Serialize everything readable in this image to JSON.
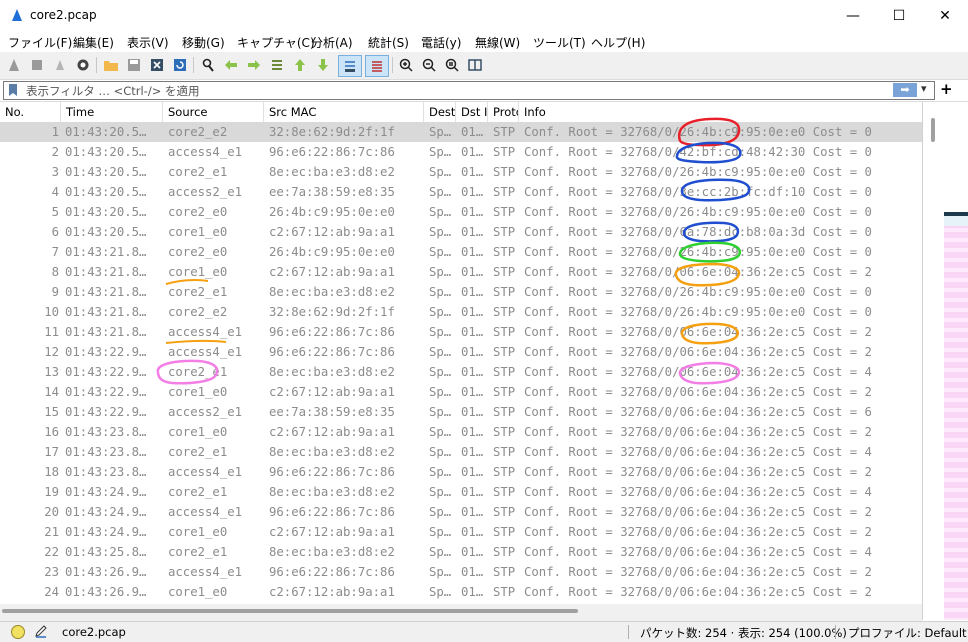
{
  "window": {
    "title": "core2.pcap",
    "min": "—",
    "max": "☐",
    "close": "✕"
  },
  "menu": [
    "ファイル(F)",
    "編集(E)",
    "表示(V)",
    "移動(G)",
    "キャプチャ(C)",
    "分析(A)",
    "統計(S)",
    "電話(y)",
    "無線(W)",
    "ツール(T)",
    "ヘルプ(H)"
  ],
  "toolbar_icons": [
    "shark-fin-start-icon",
    "stop-icon",
    "restart-icon",
    "options-gear-icon",
    "open-folder-icon",
    "save-icon",
    "close-file-icon",
    "reload-icon",
    "find-icon",
    "back-arrow-icon",
    "forward-arrow-icon",
    "goto-packet-icon",
    "first-packet-icon",
    "last-packet-icon",
    "autoscroll-icon",
    "colorize-icon",
    "zoom-in-icon",
    "zoom-out-icon",
    "zoom-normal-icon",
    "resize-columns-icon"
  ],
  "filter": {
    "placeholder": "表示フィルタ … <Ctrl-/> を適用",
    "apply": "➡",
    "dropdown": "▾",
    "add": "+"
  },
  "columns": [
    "No.",
    "Time",
    "Source",
    "Src MAC",
    "Dest",
    "Dst I",
    "Protc",
    "Info"
  ],
  "packets": [
    {
      "no": "1",
      "time": "01:43:20.5…",
      "src": "core2_e2",
      "mac": "32:8e:62:9d:2f:1f",
      "dest": "Sp…",
      "dsti": "01…",
      "proto": "STP",
      "info": "Conf. Root = 32768/0/26:4b:c9:95:0e:e0  Cost = 0"
    },
    {
      "no": "2",
      "time": "01:43:20.5…",
      "src": "access4_e1",
      "mac": "96:e6:22:86:7c:86",
      "dest": "Sp…",
      "dsti": "01…",
      "proto": "STP",
      "info": "Conf. Root = 32768/0/42:bf:cd:48:42:30  Cost = 0"
    },
    {
      "no": "3",
      "time": "01:43:20.5…",
      "src": "core2_e1",
      "mac": "8e:ec:ba:e3:d8:e2",
      "dest": "Sp…",
      "dsti": "01…",
      "proto": "STP",
      "info": "Conf. Root = 32768/0/26:4b:c9:95:0e:e0  Cost = 0"
    },
    {
      "no": "4",
      "time": "01:43:20.5…",
      "src": "access2_e1",
      "mac": "ee:7a:38:59:e8:35",
      "dest": "Sp…",
      "dsti": "01…",
      "proto": "STP",
      "info": "Conf. Root = 32768/0/3e:cc:2b:fc:df:10  Cost = 0"
    },
    {
      "no": "5",
      "time": "01:43:20.5…",
      "src": "core2_e0",
      "mac": "26:4b:c9:95:0e:e0",
      "dest": "Sp…",
      "dsti": "01…",
      "proto": "STP",
      "info": "Conf. Root = 32768/0/26:4b:c9:95:0e:e0  Cost = 0"
    },
    {
      "no": "6",
      "time": "01:43:20.5…",
      "src": "core1_e0",
      "mac": "c2:67:12:ab:9a:a1",
      "dest": "Sp…",
      "dsti": "01…",
      "proto": "STP",
      "info": "Conf. Root = 32768/0/6a:78:dc:b8:0a:3d  Cost = 0"
    },
    {
      "no": "7",
      "time": "01:43:21.8…",
      "src": "core2_e0",
      "mac": "26:4b:c9:95:0e:e0",
      "dest": "Sp…",
      "dsti": "01…",
      "proto": "STP",
      "info": "Conf. Root = 32768/0/26:4b:c9:95:0e:e0  Cost = 0"
    },
    {
      "no": "8",
      "time": "01:43:21.8…",
      "src": "core1_e0",
      "mac": "c2:67:12:ab:9a:a1",
      "dest": "Sp…",
      "dsti": "01…",
      "proto": "STP",
      "info": "Conf. Root = 32768/0/06:6e:04:36:2e:c5  Cost = 2"
    },
    {
      "no": "9",
      "time": "01:43:21.8…",
      "src": "core2_e1",
      "mac": "8e:ec:ba:e3:d8:e2",
      "dest": "Sp…",
      "dsti": "01…",
      "proto": "STP",
      "info": "Conf. Root = 32768/0/26:4b:c9:95:0e:e0  Cost = 0"
    },
    {
      "no": "10",
      "time": "01:43:21.8…",
      "src": "core2_e2",
      "mac": "32:8e:62:9d:2f:1f",
      "dest": "Sp…",
      "dsti": "01…",
      "proto": "STP",
      "info": "Conf. Root = 32768/0/26:4b:c9:95:0e:e0  Cost = 0"
    },
    {
      "no": "11",
      "time": "01:43:21.8…",
      "src": "access4_e1",
      "mac": "96:e6:22:86:7c:86",
      "dest": "Sp…",
      "dsti": "01…",
      "proto": "STP",
      "info": "Conf. Root = 32768/0/06:6e:04:36:2e:c5  Cost = 2"
    },
    {
      "no": "12",
      "time": "01:43:22.9…",
      "src": "access4_e1",
      "mac": "96:e6:22:86:7c:86",
      "dest": "Sp…",
      "dsti": "01…",
      "proto": "STP",
      "info": "Conf. Root = 32768/0/06:6e:04:36:2e:c5  Cost = 2"
    },
    {
      "no": "13",
      "time": "01:43:22.9…",
      "src": "core2_e1",
      "mac": "8e:ec:ba:e3:d8:e2",
      "dest": "Sp…",
      "dsti": "01…",
      "proto": "STP",
      "info": "Conf. Root = 32768/0/06:6e:04:36:2e:c5  Cost = 4"
    },
    {
      "no": "14",
      "time": "01:43:22.9…",
      "src": "core1_e0",
      "mac": "c2:67:12:ab:9a:a1",
      "dest": "Sp…",
      "dsti": "01…",
      "proto": "STP",
      "info": "Conf. Root = 32768/0/06:6e:04:36:2e:c5  Cost = 2"
    },
    {
      "no": "15",
      "time": "01:43:22.9…",
      "src": "access2_e1",
      "mac": "ee:7a:38:59:e8:35",
      "dest": "Sp…",
      "dsti": "01…",
      "proto": "STP",
      "info": "Conf. Root = 32768/0/06:6e:04:36:2e:c5  Cost = 6"
    },
    {
      "no": "16",
      "time": "01:43:23.8…",
      "src": "core1_e0",
      "mac": "c2:67:12:ab:9a:a1",
      "dest": "Sp…",
      "dsti": "01…",
      "proto": "STP",
      "info": "Conf. Root = 32768/0/06:6e:04:36:2e:c5  Cost = 2"
    },
    {
      "no": "17",
      "time": "01:43:23.8…",
      "src": "core2_e1",
      "mac": "8e:ec:ba:e3:d8:e2",
      "dest": "Sp…",
      "dsti": "01…",
      "proto": "STP",
      "info": "Conf. Root = 32768/0/06:6e:04:36:2e:c5  Cost = 4"
    },
    {
      "no": "18",
      "time": "01:43:23.8…",
      "src": "access4_e1",
      "mac": "96:e6:22:86:7c:86",
      "dest": "Sp…",
      "dsti": "01…",
      "proto": "STP",
      "info": "Conf. Root = 32768/0/06:6e:04:36:2e:c5  Cost = 2"
    },
    {
      "no": "19",
      "time": "01:43:24.9…",
      "src": "core2_e1",
      "mac": "8e:ec:ba:e3:d8:e2",
      "dest": "Sp…",
      "dsti": "01…",
      "proto": "STP",
      "info": "Conf. Root = 32768/0/06:6e:04:36:2e:c5  Cost = 4"
    },
    {
      "no": "20",
      "time": "01:43:24.9…",
      "src": "access4_e1",
      "mac": "96:e6:22:86:7c:86",
      "dest": "Sp…",
      "dsti": "01…",
      "proto": "STP",
      "info": "Conf. Root = 32768/0/06:6e:04:36:2e:c5  Cost = 2"
    },
    {
      "no": "21",
      "time": "01:43:24.9…",
      "src": "core1_e0",
      "mac": "c2:67:12:ab:9a:a1",
      "dest": "Sp…",
      "dsti": "01…",
      "proto": "STP",
      "info": "Conf. Root = 32768/0/06:6e:04:36:2e:c5  Cost = 2"
    },
    {
      "no": "22",
      "time": "01:43:25.8…",
      "src": "core2_e1",
      "mac": "8e:ec:ba:e3:d8:e2",
      "dest": "Sp…",
      "dsti": "01…",
      "proto": "STP",
      "info": "Conf. Root = 32768/0/06:6e:04:36:2e:c5  Cost = 4"
    },
    {
      "no": "23",
      "time": "01:43:26.9…",
      "src": "access4_e1",
      "mac": "96:e6:22:86:7c:86",
      "dest": "Sp…",
      "dsti": "01…",
      "proto": "STP",
      "info": "Conf. Root = 32768/0/06:6e:04:36:2e:c5  Cost = 2"
    },
    {
      "no": "24",
      "time": "01:43:26.9…",
      "src": "core1_e0",
      "mac": "c2:67:12:ab:9a:a1",
      "dest": "Sp…",
      "dsti": "01…",
      "proto": "STP",
      "info": "Conf. Root = 32768/0/06:6e:04:36:2e:c5  Cost = 2"
    }
  ],
  "selected_row": 0,
  "status": {
    "file": "core2.pcap",
    "packets": "パケット数: 254 · 表示: 254 (100.0%)",
    "profile": "プロファイル: Default"
  },
  "colors": {
    "row_text": "#8c8c8c",
    "selected_row": "#d9d9d9",
    "ann_red": "#e8202a",
    "ann_blue": "#1f4fd0",
    "ann_green": "#2fd02f",
    "ann_orange": "#f5a011",
    "ann_pink": "#f27ee6"
  }
}
